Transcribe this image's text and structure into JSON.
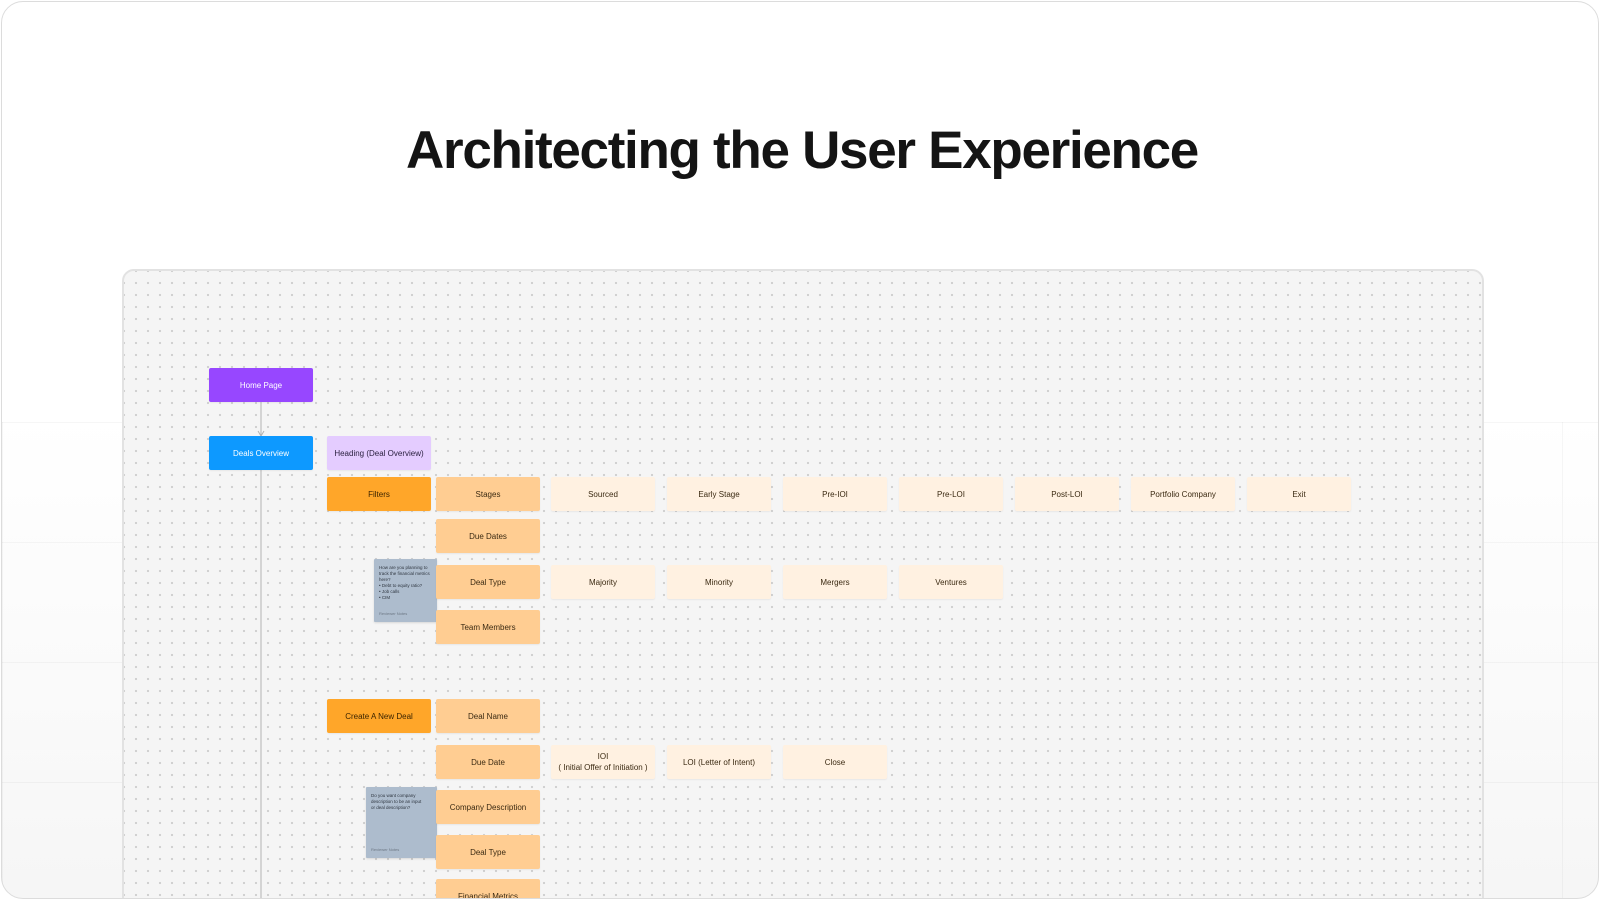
{
  "page": {
    "title": "Architecting the User Experience"
  },
  "colors": {
    "root": "#9747ff",
    "primary": "#0d99ff",
    "heading": "#e4ccff",
    "section": "#ffa629",
    "field": "#ffcd92",
    "option": "#fff1e1",
    "sticky": "#adbccd",
    "connector": "#b4b4b4"
  },
  "diagram": {
    "root": {
      "label": "Home Page"
    },
    "deals_overview": {
      "label": "Deals Overview",
      "heading": "Heading (Deal Overview)",
      "filters": {
        "label": "Filters",
        "stages": {
          "label": "Stages",
          "options": [
            "Sourced",
            "Early Stage",
            "Pre-IOI",
            "Pre-LOI",
            "Post-LOI",
            "Portfolio Company",
            "Exit"
          ]
        },
        "due_dates": {
          "label": "Due Dates"
        },
        "deal_type": {
          "label": "Deal Type",
          "options": [
            "Majority",
            "Minority",
            "Mergers",
            "Ventures"
          ]
        },
        "team_members": {
          "label": "Team Members"
        }
      },
      "create_deal": {
        "label": "Create A New Deal",
        "deal_name": {
          "label": "Deal Name"
        },
        "due_date": {
          "label": "Due Date",
          "options": [
            "IOI\n( Initial Offer of Initiation )",
            "LOI (Letter of Intent)",
            "Close"
          ]
        },
        "company_description": {
          "label": "Company Description"
        },
        "deal_type": {
          "label": "Deal Type"
        },
        "financial_metrics": {
          "label": "Financial Metrics"
        }
      }
    },
    "stickies": [
      {
        "lines": [
          "How are you planning to",
          "track the financial metrics",
          "here?",
          "• Debt to equity ratio?",
          "• Job calls",
          "• CIM"
        ],
        "author": "Reviewer Notes"
      },
      {
        "lines": [
          "Do you want company",
          "description to be an input",
          "or deal description?"
        ],
        "author": "Reviewer Notes"
      }
    ]
  }
}
